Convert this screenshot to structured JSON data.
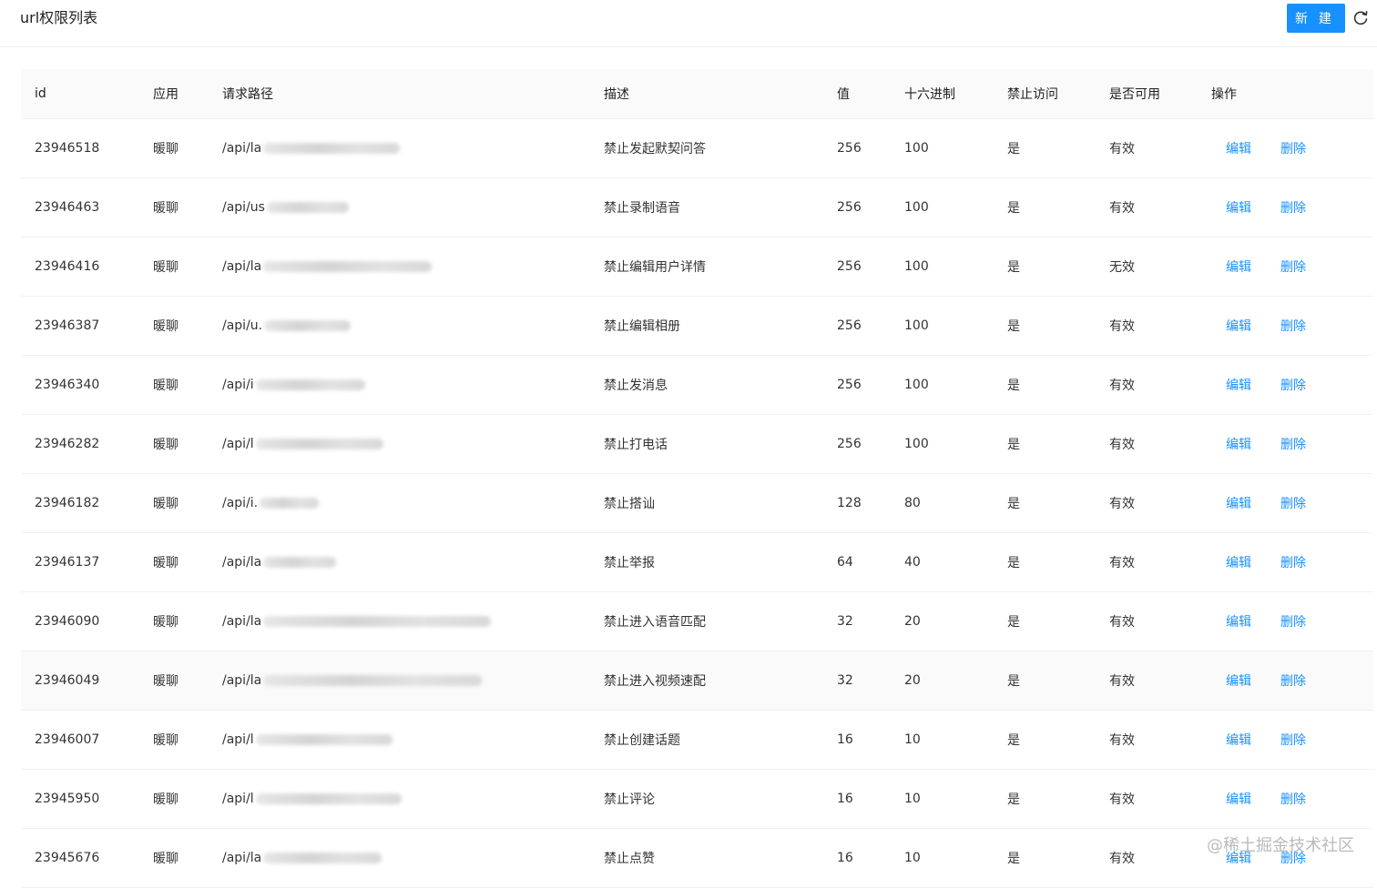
{
  "header": {
    "title": "url权限列表",
    "new_label": "新 建",
    "refresh_icon": "refresh-icon"
  },
  "table": {
    "columns": [
      "id",
      "应用",
      "请求路径",
      "描述",
      "值",
      "十六进制",
      "禁止访问",
      "是否可用",
      "操作"
    ],
    "edit_label": "编辑",
    "delete_label": "删除",
    "rows": [
      {
        "id": "23946518",
        "app": "暖聊",
        "path": "/api/la",
        "desc": "禁止发起默契问答",
        "value": "256",
        "hex": "100",
        "forbid": "是",
        "avail": "有效"
      },
      {
        "id": "23946463",
        "app": "暖聊",
        "path": "/api/us",
        "desc": "禁止录制语音",
        "value": "256",
        "hex": "100",
        "forbid": "是",
        "avail": "有效"
      },
      {
        "id": "23946416",
        "app": "暖聊",
        "path": "/api/la",
        "desc": "禁止编辑用户详情",
        "value": "256",
        "hex": "100",
        "forbid": "是",
        "avail": "无效"
      },
      {
        "id": "23946387",
        "app": "暖聊",
        "path": "/api/u.",
        "desc": "禁止编辑相册",
        "value": "256",
        "hex": "100",
        "forbid": "是",
        "avail": "有效"
      },
      {
        "id": "23946340",
        "app": "暖聊",
        "path": "/api/i",
        "desc": "禁止发消息",
        "value": "256",
        "hex": "100",
        "forbid": "是",
        "avail": "有效"
      },
      {
        "id": "23946282",
        "app": "暖聊",
        "path": "/api/l",
        "desc": "禁止打电话",
        "value": "256",
        "hex": "100",
        "forbid": "是",
        "avail": "有效"
      },
      {
        "id": "23946182",
        "app": "暖聊",
        "path": "/api/i.",
        "desc": "禁止搭讪",
        "value": "128",
        "hex": "80",
        "forbid": "是",
        "avail": "有效"
      },
      {
        "id": "23946137",
        "app": "暖聊",
        "path": "/api/la",
        "desc": "禁止举报",
        "value": "64",
        "hex": "40",
        "forbid": "是",
        "avail": "有效"
      },
      {
        "id": "23946090",
        "app": "暖聊",
        "path": "/api/la",
        "desc": "禁止进入语音匹配",
        "value": "32",
        "hex": "20",
        "forbid": "是",
        "avail": "有效"
      },
      {
        "id": "23946049",
        "app": "暖聊",
        "path": "/api/la",
        "desc": "禁止进入视频速配",
        "value": "32",
        "hex": "20",
        "forbid": "是",
        "avail": "有效"
      },
      {
        "id": "23946007",
        "app": "暖聊",
        "path": "/api/l",
        "desc": "禁止创建话题",
        "value": "16",
        "hex": "10",
        "forbid": "是",
        "avail": "有效"
      },
      {
        "id": "23945950",
        "app": "暖聊",
        "path": "/api/l",
        "desc": "禁止评论",
        "value": "16",
        "hex": "10",
        "forbid": "是",
        "avail": "有效"
      },
      {
        "id": "23945676",
        "app": "暖聊",
        "path": "/api/la",
        "desc": "禁止点赞",
        "value": "16",
        "hex": "10",
        "forbid": "是",
        "avail": "有效"
      }
    ]
  },
  "watermark": "@稀土掘金技术社区"
}
